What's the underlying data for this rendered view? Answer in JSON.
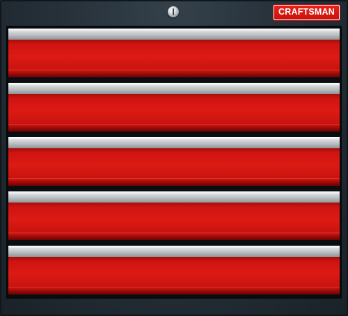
{
  "brand": {
    "logo_text": "CRAFTSMAN",
    "logo_color": "#d8160f"
  },
  "cabinet": {
    "body_color": "#26313a",
    "drawer_color": "#dd1a14",
    "handle_color": "#c9ccce",
    "drawers": [
      {
        "name": "drawer-1"
      },
      {
        "name": "drawer-2"
      },
      {
        "name": "drawer-3"
      },
      {
        "name": "drawer-4"
      },
      {
        "name": "drawer-5"
      }
    ]
  },
  "icons": {
    "lock": "keyhole-lock-icon"
  }
}
